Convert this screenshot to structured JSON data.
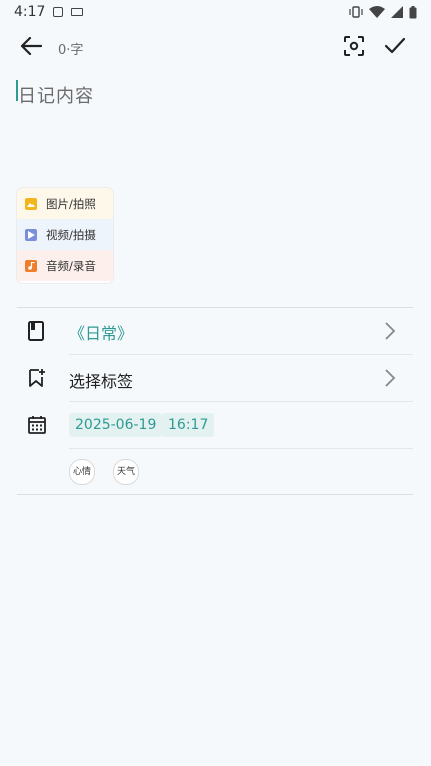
{
  "status_bar": {
    "time": "4:17"
  },
  "toolbar": {
    "word_count": "0·字"
  },
  "editor": {
    "placeholder": "日记内容"
  },
  "media_menu": {
    "items": [
      {
        "label": "图片/拍照",
        "color": "#f2b51c"
      },
      {
        "label": "视频/拍摄",
        "color": "#7b8ed9"
      },
      {
        "label": "音频/录音",
        "color": "#ef7d2a"
      }
    ]
  },
  "meta": {
    "notebook": "《日常》",
    "tags_label": "选择标签",
    "date": "2025-06-19",
    "time": "16:17",
    "mood_label": "心情",
    "weather_label": "天气"
  },
  "colors": {
    "accent": "#2e9a92",
    "background": "#f5f9fc"
  }
}
